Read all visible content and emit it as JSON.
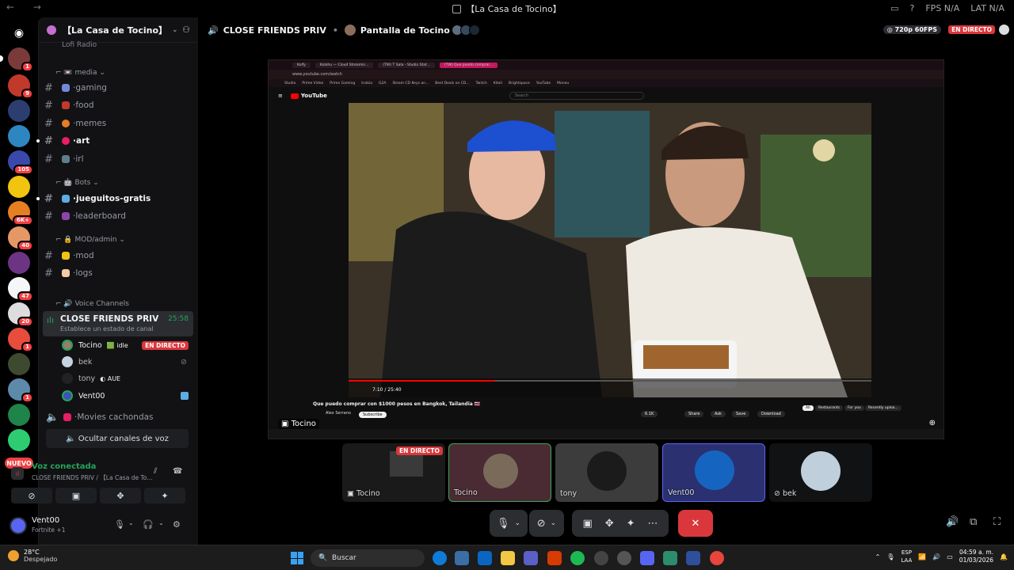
{
  "window": {
    "title": "【La Casa de Tocino】",
    "stats": [
      "FPS N/A",
      "LAT N/A"
    ]
  },
  "rail": {
    "badges": [
      "1",
      "9",
      "",
      "",
      "105",
      "",
      "6K+",
      "40",
      "",
      "47",
      "20",
      "1",
      "",
      "1",
      ""
    ],
    "new_label": "NUEVO"
  },
  "server": {
    "name": "【La Casa de Tocino】"
  },
  "sidebar": {
    "partial_channel": "Lofi Radio",
    "categories": {
      "media": "media",
      "bots": "Bots",
      "mod": "MOD/admin",
      "voice": "Voice Channels"
    },
    "channels": [
      {
        "label": "gaming",
        "bold": false
      },
      {
        "label": "food",
        "bold": false
      },
      {
        "label": "memes",
        "bold": false
      },
      {
        "label": "art",
        "bold": true
      },
      {
        "label": "irl",
        "bold": false
      },
      {
        "label": "jueguitos-gratis",
        "bold": true
      },
      {
        "label": "leaderboard",
        "bold": false
      },
      {
        "label": "mod",
        "bold": false
      },
      {
        "label": "logs",
        "bold": false
      }
    ],
    "active_voice": {
      "name": "CLOSE FRIENDS PRIV",
      "time": "25:58",
      "status": "Establece un estado de canal"
    },
    "voice_users": [
      {
        "name": "Tocino",
        "tag": "idle",
        "live": "EN DIRECTO"
      },
      {
        "name": "bek",
        "tag": "",
        "live": ""
      },
      {
        "name": "tony",
        "tag": "AUE",
        "live": ""
      },
      {
        "name": "Vent00",
        "tag": "",
        "live": ""
      }
    ],
    "other_voice": "Movies cachondas",
    "hide_voice_label": "Ocultar canales de voz"
  },
  "voice_panel": {
    "title": "Voz conectada",
    "subtitle": "CLOSE FRIENDS PRIV / 【La Casa de To..."
  },
  "user_panel": {
    "name": "Vent00",
    "status": "Fortnite +1"
  },
  "main": {
    "channel": "CLOSE FRIENDS PRIV",
    "stream_title": "Pantalla de Tocino",
    "quality": "720p 60FPS",
    "live": "EN DIRECTO"
  },
  "stream": {
    "tabs": [
      "Kolfy",
      "Kolohu — Cloud Streamin...",
      "(TW) T Sala - Studio Stat...",
      "(TW) Que puedo comprar..."
    ],
    "url": "www.youtube.com/watch",
    "bookmarks": [
      "Studio",
      "Prime Video",
      "Prime Gaming",
      "krakia",
      "G2A",
      "Steam CD Keys an...",
      "Best Deals on CD...",
      "Twitch",
      "Kitoli",
      "Brightspace",
      "YouTube",
      "Moneu"
    ],
    "yt_logo": "YouTube",
    "search_placeholder": "Search",
    "time": "7:10 / 25:40",
    "video_title": "Que puedo comprar con $1000 pesos en Bangkok, Tailandia 🇹🇭",
    "channel": "Alex Serrano",
    "subscribers": "3.6M subscribers",
    "subscribe": "Subscribe",
    "actions": [
      "6.1K",
      "Share",
      "Ask",
      "Save",
      "Download"
    ],
    "chips": [
      "All",
      "Restaurants",
      "For you",
      "Recently uploa..."
    ],
    "label": "Tocino"
  },
  "tiles": [
    {
      "name": "Tocino",
      "live": "EN DIRECTO"
    },
    {
      "name": "Tocino",
      "live": ""
    },
    {
      "name": "tony",
      "live": ""
    },
    {
      "name": "Vent00",
      "live": ""
    },
    {
      "name": "bek",
      "live": ""
    }
  ],
  "taskbar": {
    "weather_temp": "28°C",
    "weather_desc": "Despejado",
    "search": "Buscar",
    "lang": "ESP",
    "lang2": "LAA",
    "time": "04:59 a. m.",
    "date": "01/03/2026"
  }
}
